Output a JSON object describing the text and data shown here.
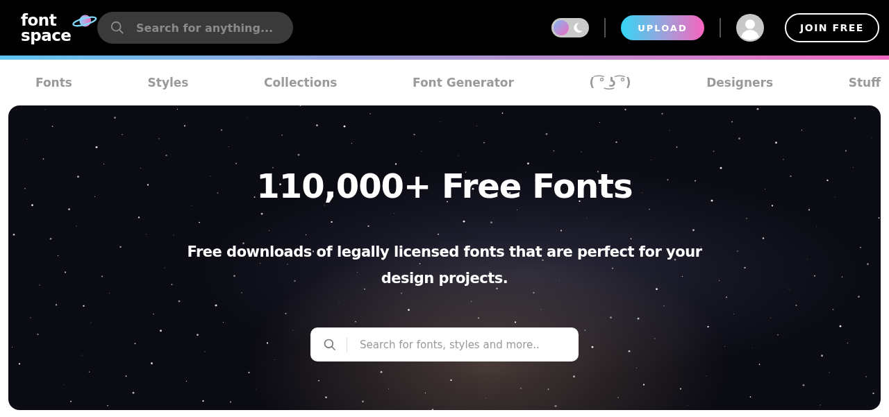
{
  "header": {
    "logo": {
      "line_1": "font",
      "line_2": "space"
    },
    "search": {
      "placeholder": "Search for anything..."
    },
    "theme_toggle": {
      "on": false
    },
    "upload_button": "UPLOAD",
    "join_button": "JOIN FREE"
  },
  "nav": {
    "items": [
      {
        "label": "Fonts"
      },
      {
        "label": "Styles"
      },
      {
        "label": "Collections"
      },
      {
        "label": "Font Generator"
      },
      {
        "label": "( ͡° ͜ʖ ͡°)"
      },
      {
        "label": "Designers"
      },
      {
        "label": "Stuff"
      }
    ]
  },
  "hero": {
    "title": "110,000+ Free Fonts",
    "subtitle": "Free downloads of legally licensed fonts that are perfect for your design projects.",
    "search": {
      "placeholder": "Search for fonts, styles and more.."
    }
  }
}
